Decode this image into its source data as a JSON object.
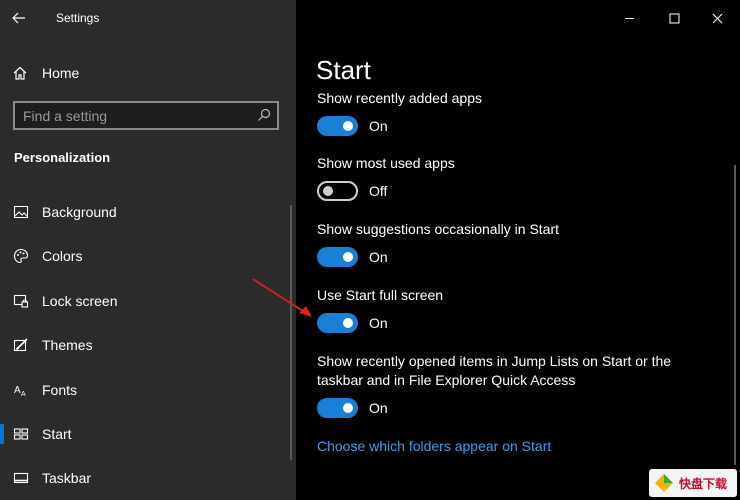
{
  "window": {
    "title": "Settings",
    "controls": [
      "minimize-icon",
      "maximize-icon",
      "close-icon"
    ]
  },
  "sidebar": {
    "home_label": "Home",
    "search": {
      "placeholder": "Find a setting"
    },
    "section_title": "Personalization",
    "items": [
      {
        "label": "Background",
        "icon": "picture-icon"
      },
      {
        "label": "Colors",
        "icon": "palette-icon"
      },
      {
        "label": "Lock screen",
        "icon": "lock-screen-icon"
      },
      {
        "label": "Themes",
        "icon": "themes-icon"
      },
      {
        "label": "Fonts",
        "icon": "fonts-icon"
      },
      {
        "label": "Start",
        "icon": "start-icon",
        "active": true
      },
      {
        "label": "Taskbar",
        "icon": "taskbar-icon"
      }
    ]
  },
  "main": {
    "page_title": "Start",
    "settings": [
      {
        "label": "Show recently added apps",
        "state": "On"
      },
      {
        "label": "Show most used apps",
        "state": "Off"
      },
      {
        "label": "Show suggestions occasionally in Start",
        "state": "On"
      },
      {
        "label": "Use Start full screen",
        "state": "On"
      },
      {
        "label_line1": "Show recently opened items in Jump Lists on Start or the",
        "label_line2": "taskbar and in File Explorer Quick Access",
        "state": "On"
      }
    ],
    "link": "Choose which folders appear on Start"
  },
  "colors": {
    "accent": "#0078d7",
    "toggle_on": "#1a7fd6",
    "link": "#3aa0e8",
    "sidebar_bg": "#2b2b2b",
    "annotation_arrow": "#e02020"
  },
  "watermark": {
    "text": "快盘下载"
  }
}
